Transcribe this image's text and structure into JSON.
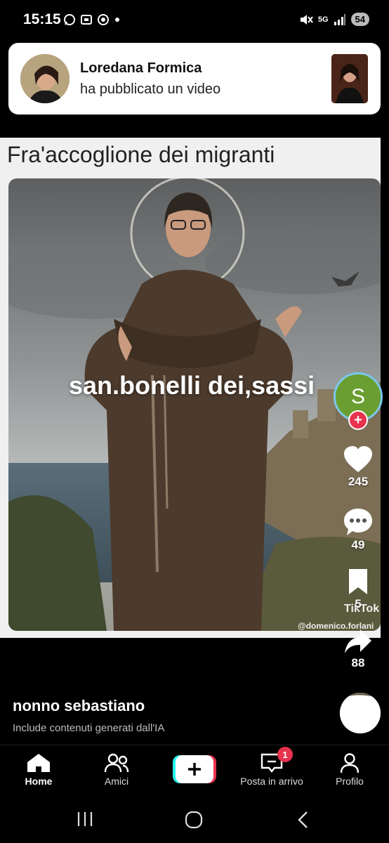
{
  "status_bar": {
    "time": "15:15",
    "network": "5G",
    "battery": "54",
    "icons": [
      "whatsapp-icon",
      "screenshot-icon",
      "chrome-icon",
      "dot-icon",
      "mute-icon",
      "signal-icon"
    ]
  },
  "notification": {
    "title": "Loredana Formica",
    "subtitle": "ha pubblicato un video"
  },
  "video": {
    "caption": "Fra'accoglione dei migranti",
    "overlay_text": "san.bonelli dei,sassi",
    "watermark": "TikTok",
    "watermark_handle": "@domenico.forlani"
  },
  "creator": {
    "initial": "S"
  },
  "actions": {
    "likes": "245",
    "comments": "49",
    "saves": "5",
    "shares": "88"
  },
  "post": {
    "author": "nonno sebastiano",
    "ai_label": "Include contenuti generati dall'IA"
  },
  "tabs": [
    {
      "label": "Home",
      "icon": "home-icon",
      "active": true
    },
    {
      "label": "Amici",
      "icon": "friends-icon"
    },
    {
      "label": "",
      "icon": "create-icon"
    },
    {
      "label": "Posta in arrivo",
      "icon": "inbox-icon",
      "badge": "1"
    },
    {
      "label": "Profilo",
      "icon": "profile-icon"
    }
  ],
  "colors": {
    "accent_red": "#e8334e",
    "tiktok_cyan": "#25f4ee",
    "background": "#000000"
  }
}
